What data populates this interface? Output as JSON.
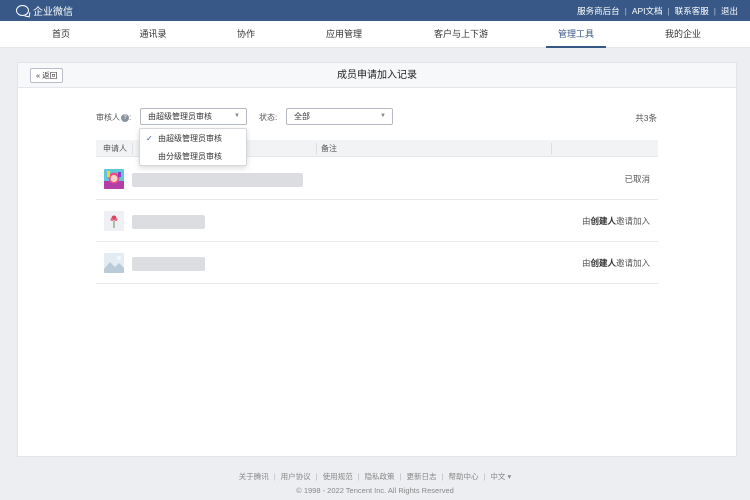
{
  "topbar": {
    "brand": "企业微信",
    "links": [
      "服务商后台",
      "API文档",
      "联系客服",
      "退出"
    ]
  },
  "nav": {
    "items": [
      "首页",
      "通讯录",
      "协作",
      "应用管理",
      "客户与上下游",
      "管理工具",
      "我的企业"
    ],
    "active": "管理工具"
  },
  "panel": {
    "back_label": "« 返回",
    "title": "成员申请加入记录"
  },
  "filters": {
    "reviewer_label": "审核人",
    "reviewer_help": "?",
    "reviewer_colon": ":",
    "reviewer_value": "由超级管理员审核",
    "status_label": "状态:",
    "status_value": "全部",
    "count_text": "共3条"
  },
  "dropdown": {
    "options": [
      "由超级管理员审核",
      "由分级管理员审核"
    ],
    "selected_index": 0
  },
  "table": {
    "headers": [
      "申请人",
      "备注"
    ],
    "rows": [
      {
        "status": "已取消",
        "avatar": "colorful-cartoon-avatar"
      },
      {
        "status_prefix": "由",
        "status_bold": "创建人",
        "status_suffix": "邀请加入",
        "avatar": "flower-avatar"
      },
      {
        "status_prefix": "由",
        "status_bold": "创建人",
        "status_suffix": "邀请加入",
        "avatar": "landscape-avatar"
      }
    ]
  },
  "footer": {
    "links": [
      "关于腾讯",
      "用户协议",
      "使用规范",
      "隐私政策",
      "更新日志",
      "帮助中心",
      "中文 ▾"
    ],
    "copyright": "© 1998 - 2022 Tencent Inc. All Rights Reserved"
  },
  "colors": {
    "topbar": "#385987",
    "accent": "#385987",
    "background": "#eceef1"
  }
}
